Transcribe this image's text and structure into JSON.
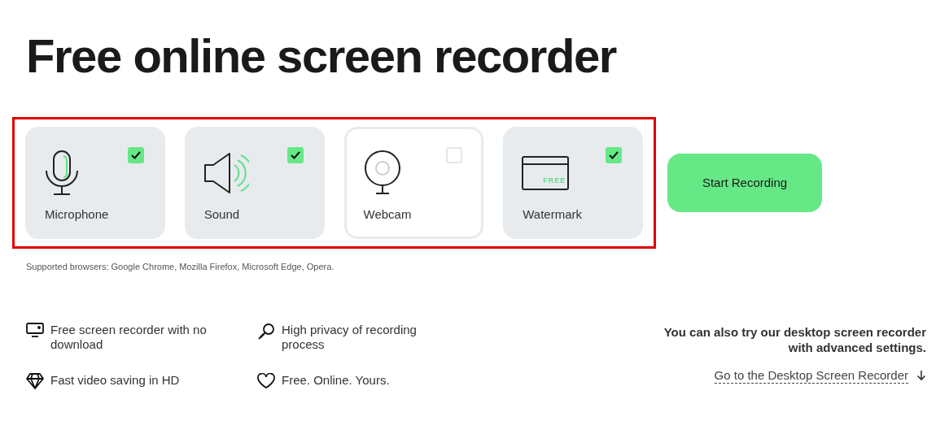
{
  "heading": "Free online screen recorder",
  "options": [
    {
      "kind": "microphone",
      "label": "Microphone",
      "checked": true
    },
    {
      "kind": "sound",
      "label": "Sound",
      "checked": true
    },
    {
      "kind": "webcam",
      "label": "Webcam",
      "checked": false
    },
    {
      "kind": "watermark",
      "label": "Watermark",
      "checked": true,
      "badge": "FREE"
    }
  ],
  "start_button": "Start Recording",
  "supported_note": "Supported browsers: Google Chrome, Mozilla Firefox, Microsoft Edge, Opera.",
  "features": [
    {
      "kind": "monitor",
      "text": "Free screen recorder with no download"
    },
    {
      "kind": "key",
      "text": "High privacy of recording process"
    },
    {
      "kind": "diamond",
      "text": "Fast video saving in HD"
    },
    {
      "kind": "heart",
      "text": "Free. Online. Yours."
    }
  ],
  "desktop_promo": {
    "text": "You can also try our desktop screen recorder with advanced settings.",
    "link": "Go to the Desktop Screen Recorder"
  }
}
